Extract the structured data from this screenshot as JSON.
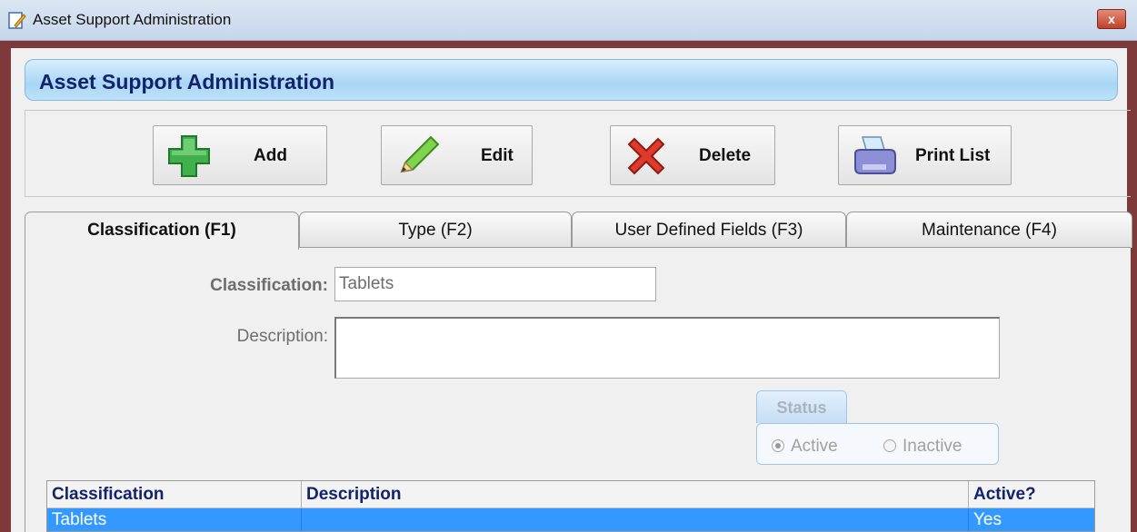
{
  "window": {
    "title": "Asset Support Administration",
    "close_glyph": "x"
  },
  "banner": {
    "title": "Asset Support Administration"
  },
  "toolbar": {
    "add": {
      "label": "Add",
      "icon": "plus-icon",
      "color": "#3fb04a"
    },
    "edit": {
      "label": "Edit",
      "icon": "pencil-icon",
      "color": "#7fd34d"
    },
    "delete": {
      "label": "Delete",
      "icon": "delete-x-icon",
      "color": "#e03a2c"
    },
    "print": {
      "label": "Print List",
      "icon": "printer-icon",
      "color": "#8d8fd6"
    }
  },
  "tabs": [
    {
      "label": "Classification (F1)",
      "active": true
    },
    {
      "label": "Type (F2)",
      "active": false
    },
    {
      "label": "User Defined Fields (F3)",
      "active": false
    },
    {
      "label": "Maintenance (F4)",
      "active": false
    }
  ],
  "form": {
    "classification_label": "Classification:",
    "classification_value": "Tablets",
    "description_label": "Description:",
    "description_value": ""
  },
  "status": {
    "label": "Status",
    "options": [
      {
        "label": "Active",
        "selected": true
      },
      {
        "label": "Inactive",
        "selected": false
      }
    ]
  },
  "grid": {
    "columns": [
      "Classification",
      "Description",
      "Active?"
    ],
    "rows": [
      {
        "classification": "Tablets",
        "description": "",
        "active": "Yes",
        "selected": true
      }
    ],
    "selected_color": "#3399ff"
  }
}
